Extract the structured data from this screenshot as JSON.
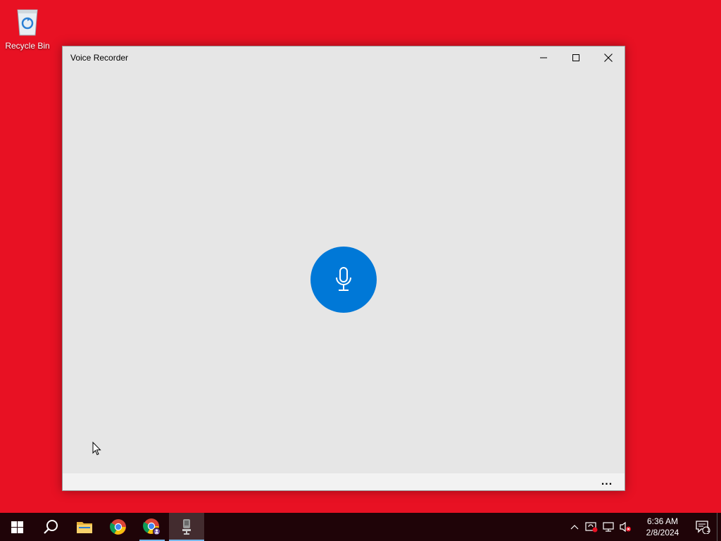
{
  "desktop": {
    "background_color": "#e81123",
    "icons": [
      {
        "label": "Recycle Bin",
        "icon": "recycle-bin-icon"
      }
    ]
  },
  "window": {
    "title": "Voice Recorder",
    "caption_buttons": [
      "minimize-icon",
      "maximize-icon",
      "close-icon"
    ],
    "record_button": {
      "icon": "microphone-icon",
      "color": "#0078d7"
    },
    "more_options_label": "..."
  },
  "taskbar": {
    "apps": [
      {
        "name": "start",
        "icon": "windows-logo-icon"
      },
      {
        "name": "search",
        "icon": "search-icon"
      },
      {
        "name": "file-explorer",
        "icon": "folder-icon"
      },
      {
        "name": "chrome",
        "icon": "chrome-icon"
      },
      {
        "name": "chrome-profile",
        "icon": "chrome-icon",
        "running": true
      },
      {
        "name": "voice-recorder",
        "icon": "microphone-icon",
        "active": true
      }
    ],
    "tray_icons": [
      "chevron-up-icon",
      "defender-icon",
      "network-icon",
      "volume-muted-icon"
    ],
    "clock": {
      "time": "6:36 AM",
      "date": "2/8/2024"
    },
    "notification_count": "1"
  }
}
